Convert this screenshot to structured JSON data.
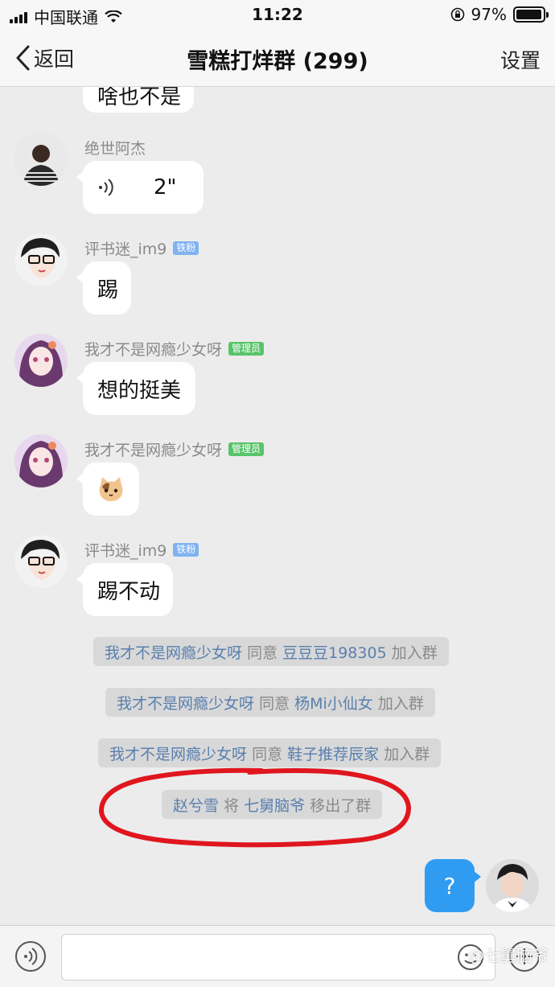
{
  "status_bar": {
    "carrier": "中国联通",
    "time": "11:22",
    "battery_percent": "97%",
    "battery_level": 0.97
  },
  "nav": {
    "back_label": "返回",
    "title": "雪糕打烊群 (299)",
    "settings_label": "设置"
  },
  "messages": [
    {
      "text": "啥也不是"
    },
    {
      "sender": "绝世阿杰",
      "voice_duration": "2\""
    },
    {
      "sender": "评书迷_im9",
      "badge": "铁粉",
      "text": "踢"
    },
    {
      "sender": "我才不是网瘾少女呀",
      "badge": "管理员",
      "text": "想的挺美"
    },
    {
      "sender": "我才不是网瘾少女呀",
      "badge": "管理员",
      "sticker": "cat-face-sticker"
    },
    {
      "sender": "评书迷_im9",
      "badge": "铁粉",
      "text": "踢不动"
    }
  ],
  "system_notices": [
    {
      "actor": "我才不是网瘾少女呀",
      "verb": "同意",
      "target": "豆豆豆198305",
      "suffix": "加入群"
    },
    {
      "actor": "我才不是网瘾少女呀",
      "verb": "同意",
      "target": "杨Mi小仙女",
      "suffix": "加入群"
    },
    {
      "actor": "我才不是网瘾少女呀",
      "verb": "同意",
      "target": "鞋子推荐辰家",
      "suffix": "加入群"
    },
    {
      "actor": "赵兮雪",
      "verb": "将",
      "target": "七舅脑爷",
      "suffix": "移出了群"
    }
  ],
  "my_message": {
    "text": "?"
  },
  "watermark": "@七舅脑爷",
  "colors": {
    "background": "#ececec",
    "bubble": "#ffffff",
    "my_bubble": "#2f9cf2",
    "system_name": "#5a7fae",
    "annotation_red": "#e0161e",
    "badge_blue": "#7fb2f0",
    "badge_green": "#58c46a"
  }
}
